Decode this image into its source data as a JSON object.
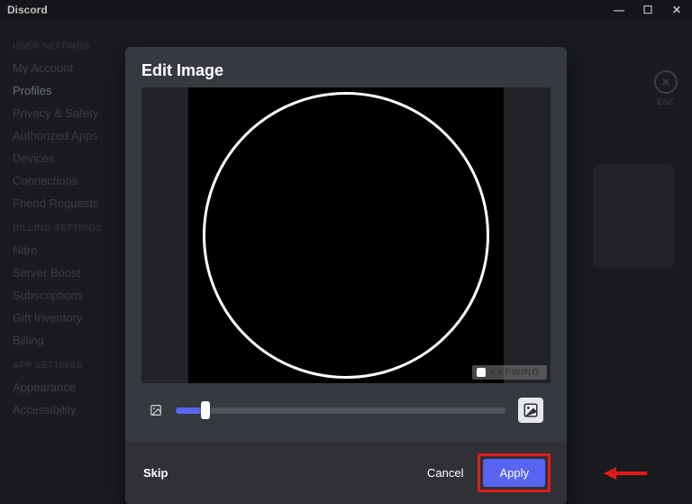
{
  "titlebar": {
    "app_name": "Discord"
  },
  "esc": {
    "label": "ESC",
    "glyph": "✕"
  },
  "sidebar": {
    "section1_heading": "USER SETTINGS",
    "section1": [
      {
        "label": "My Account"
      },
      {
        "label": "Profiles"
      },
      {
        "label": "Privacy & Safety"
      },
      {
        "label": "Authorized Apps"
      },
      {
        "label": "Devices"
      },
      {
        "label": "Connections"
      },
      {
        "label": "Friend Requests"
      }
    ],
    "section2_heading": "BILLING SETTINGS",
    "section2": [
      {
        "label": "Nitro"
      },
      {
        "label": "Server Boost"
      },
      {
        "label": "Subscriptions"
      },
      {
        "label": "Gift Inventory"
      },
      {
        "label": "Billing"
      }
    ],
    "section3_heading": "APP SETTINGS",
    "section3": [
      {
        "label": "Appearance"
      },
      {
        "label": "Accessibility"
      }
    ]
  },
  "modal": {
    "title": "Edit Image",
    "watermark": "KAPWING",
    "skip": "Skip",
    "cancel": "Cancel",
    "apply": "Apply"
  }
}
